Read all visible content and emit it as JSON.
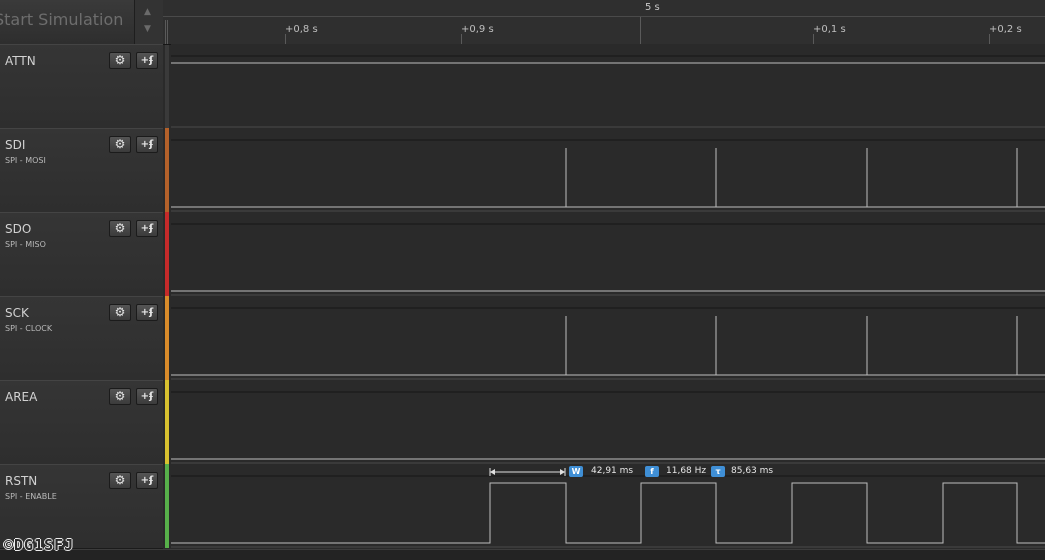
{
  "simulation": {
    "label": "Start Simulation"
  },
  "ruler": {
    "title": "5 s",
    "ticks": [
      {
        "label": "+0,8 s"
      },
      {
        "label": "+0,9 s"
      },
      {
        "label": "+0,1 s"
      },
      {
        "label": "+0,2 s"
      }
    ]
  },
  "channels": [
    {
      "name": "ATTN",
      "subtitle": "",
      "color": "#3a3a3a"
    },
    {
      "name": "SDI",
      "subtitle": "SPI - MOSI",
      "color": "#b4612a"
    },
    {
      "name": "SDO",
      "subtitle": "SPI - MISO",
      "color": "#c62a2a"
    },
    {
      "name": "SCK",
      "subtitle": "SPI - CLOCK",
      "color": "#d98b2a"
    },
    {
      "name": "AREA",
      "subtitle": "",
      "color": "#d8c12f"
    },
    {
      "name": "RSTN",
      "subtitle": "SPI - ENABLE",
      "color": "#57b04a"
    }
  ],
  "buttons": {
    "settings_icon": "gear-icon",
    "trigger_icon": "trigger-icon",
    "settings_glyph": "⚙",
    "trigger_glyph": "+ʄ"
  },
  "measurement": {
    "width_badge": "W",
    "width_value": "42,91 ms",
    "freq_badge": "f",
    "freq_value": "11,68 Hz",
    "period_badge": "τ",
    "period_value": "85,63 ms"
  },
  "watermark": "©DG1SFJ"
}
